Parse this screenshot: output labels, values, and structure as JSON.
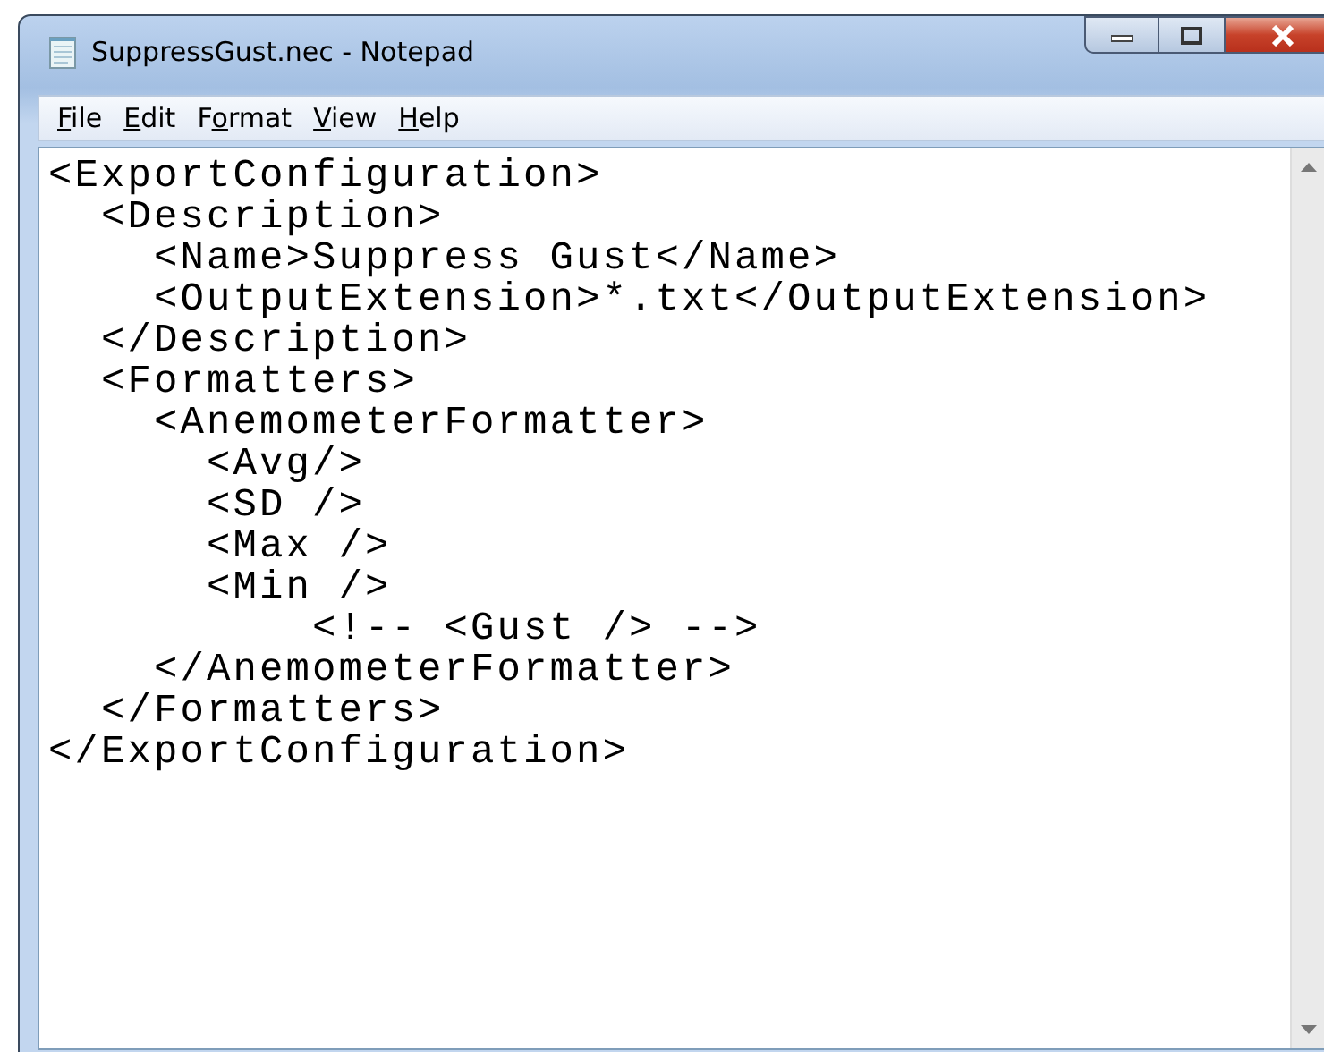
{
  "window": {
    "title": "SuppressGust.nec - Notepad"
  },
  "menu": [
    {
      "access_key": "F",
      "after_key": "ile"
    },
    {
      "access_key": "E",
      "after_key": "dit"
    },
    {
      "before_key": "F",
      "access_key": "o",
      "after_key": "rmat"
    },
    {
      "access_key": "V",
      "after_key": "iew"
    },
    {
      "access_key": "H",
      "after_key": "elp"
    }
  ],
  "editor": {
    "lines": [
      "<ExportConfiguration>",
      "  <Description>",
      "    <Name>Suppress Gust</Name>",
      "    <OutputExtension>*.txt</OutputExtension>",
      "  </Description>",
      "  <Formatters>",
      "    <AnemometerFormatter>",
      "      <Avg/>",
      "      <SD />",
      "      <Max />",
      "      <Min />",
      "          <!-- <Gust /> -->",
      "    </AnemometerFormatter>",
      "  </Formatters>",
      "</ExportConfiguration>"
    ]
  }
}
